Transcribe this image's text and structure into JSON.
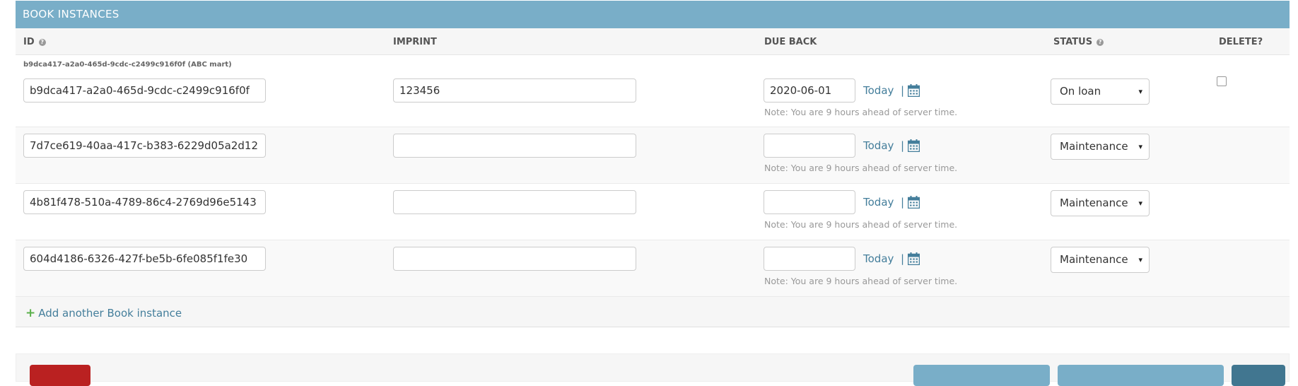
{
  "inline": {
    "title": "BOOK INSTANCES",
    "columns": {
      "id": "ID",
      "imprint": "IMPRINT",
      "due_back": "DUE BACK",
      "status": "STATUS",
      "delete": "DELETE?"
    },
    "help_glyph": "?",
    "today_label": "Today",
    "separator": "|",
    "server_note": "Note: You are 9 hours ahead of server time.",
    "select_arrow": "▾",
    "rows": [
      {
        "original": "b9dca417-a2a0-465d-9cdc-c2499c916f0f (ABC mart)",
        "id": "b9dca417-a2a0-465d-9cdc-c2499c916f0f",
        "imprint": "123456",
        "due_back": "2020-06-01",
        "status": "On loan",
        "delete_checked": false
      },
      {
        "id": "7d7ce619-40aa-417c-b383-6229d05a2d12",
        "imprint": "",
        "due_back": "",
        "status": "Maintenance"
      },
      {
        "id": "4b81f478-510a-4789-86c4-2769d96e5143",
        "imprint": "",
        "due_back": "",
        "status": "Maintenance"
      },
      {
        "id": "604d4186-6326-427f-be5b-6fe085f1fe30",
        "imprint": "",
        "due_back": "",
        "status": "Maintenance"
      }
    ],
    "add_another_label": "Add another Book instance"
  },
  "colors": {
    "header_bg": "#79aec8",
    "link": "#447e9b",
    "add_plus": "#5ab04b",
    "delete_button": "#ba2121",
    "save_button_dark": "#417690"
  }
}
